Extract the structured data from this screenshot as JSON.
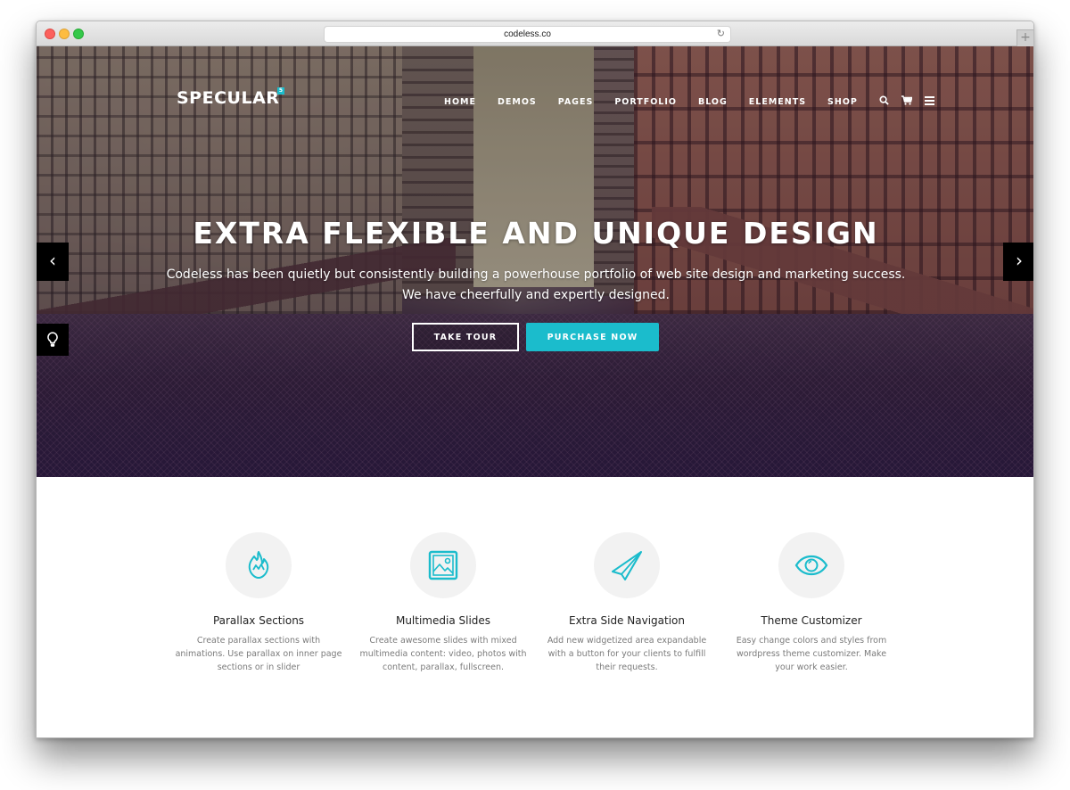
{
  "browser": {
    "url": "codeless.co",
    "reload_icon": "reload-icon",
    "new_tab_icon": "plus-icon"
  },
  "site": {
    "logo": "SPECULAR",
    "logo_badge": "5",
    "nav": {
      "items": [
        {
          "label": "HOME"
        },
        {
          "label": "DEMOS"
        },
        {
          "label": "PAGES"
        },
        {
          "label": "PORTFOLIO"
        },
        {
          "label": "BLOG"
        },
        {
          "label": "ELEMENTS"
        },
        {
          "label": "SHOP"
        }
      ],
      "icons": [
        "search-icon",
        "cart-icon",
        "menu-icon"
      ]
    },
    "hero": {
      "title": "EXTRA FLEXIBLE AND UNIQUE DESIGN",
      "subtitle_line1": "Codeless has been quietly but consistently building a powerhouse portfolio of web site design and marketing success.",
      "subtitle_line2": "We have cheerfully and expertly designed.",
      "btn_tour": "TAKE TOUR",
      "btn_purchase": "PURCHASE NOW",
      "prev_arrow": "‹",
      "next_arrow": "›"
    },
    "colors": {
      "accent": "#1bbccc",
      "icon_circle": "#f2f2f2"
    },
    "features": [
      {
        "icon": "flame-icon",
        "title": "Parallax Sections",
        "desc": "Create parallax sections with animations. Use parallax on inner page sections or in slider"
      },
      {
        "icon": "image-icon",
        "title": "Multimedia Slides",
        "desc": "Create awesome slides with mixed multimedia content: video, photos with content, parallax, fullscreen."
      },
      {
        "icon": "paper-plane-icon",
        "title": "Extra Side Navigation",
        "desc": "Add new widgetized area expandable with a button for your clients to fulfill their requests."
      },
      {
        "icon": "eye-icon",
        "title": "Theme Customizer",
        "desc": "Easy change colors and styles from wordpress theme customizer. Make your work easier."
      }
    ]
  }
}
